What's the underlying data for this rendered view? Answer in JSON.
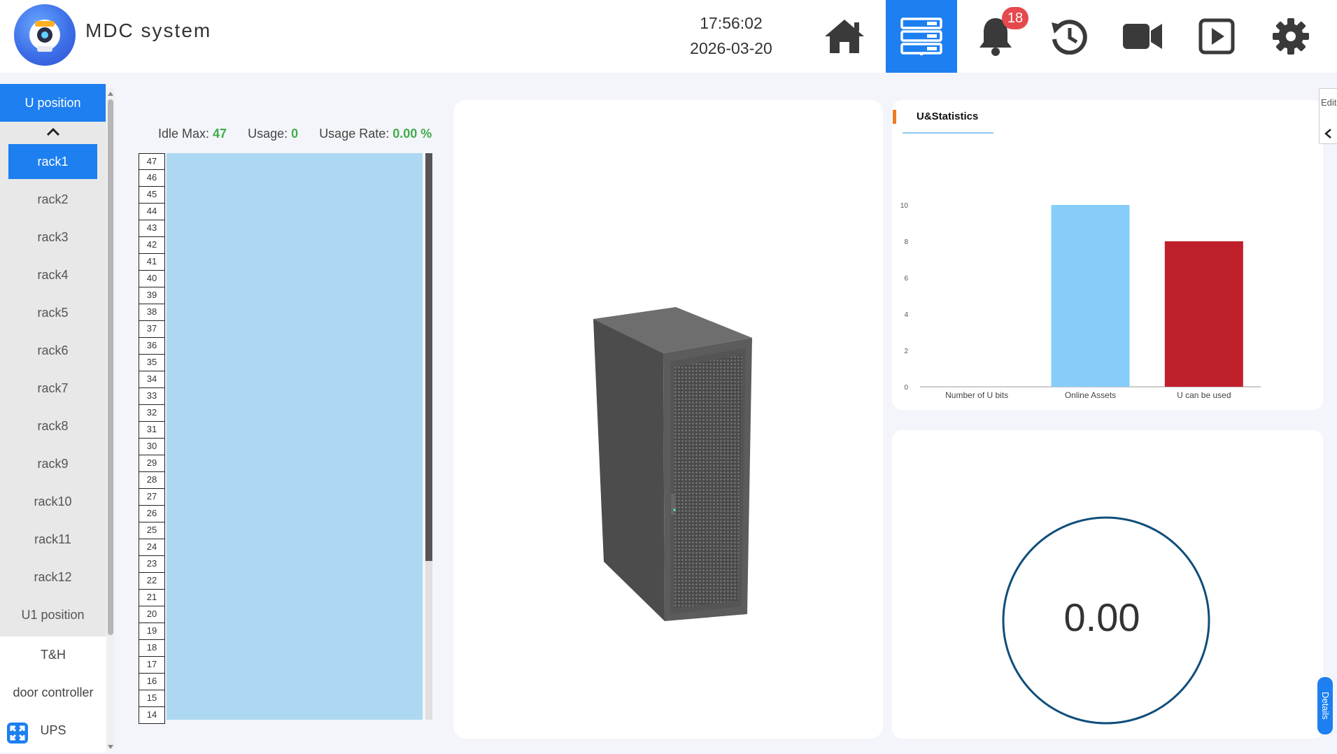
{
  "header": {
    "title": "MDC system",
    "time": "17:56:02",
    "date": "2026-03-20",
    "alarm_count": "18",
    "nav": [
      "home-icon",
      "rack-list-icon",
      "bell-icon",
      "history-icon",
      "video-icon",
      "playback-icon",
      "settings-icon"
    ],
    "active_nav": "rack-list-icon"
  },
  "sidebar": {
    "section": "U position",
    "racks": [
      "rack1",
      "rack2",
      "rack3",
      "rack4",
      "rack5",
      "rack6",
      "rack7",
      "rack8",
      "rack9",
      "rack10",
      "rack11",
      "rack12",
      "U1 position"
    ],
    "active_rack": "rack1",
    "other_items": [
      "T&H",
      "door controller",
      "UPS"
    ]
  },
  "usage": {
    "idle_label": "Idle Max:",
    "idle_value": "47",
    "usage_label": "Usage:",
    "usage_value": "0",
    "rate_label": "Usage Rate:",
    "rate_value": "0.00 %"
  },
  "u_slots": [
    "47",
    "46",
    "45",
    "44",
    "43",
    "42",
    "41",
    "40",
    "39",
    "38",
    "37",
    "36",
    "35",
    "34",
    "33",
    "32",
    "31",
    "30",
    "29",
    "28",
    "27",
    "26",
    "25",
    "24",
    "23",
    "22",
    "21",
    "20",
    "19",
    "18",
    "17",
    "16",
    "15",
    "14"
  ],
  "stats": {
    "title": "U&Statistics",
    "edit_label": "Edit"
  },
  "chart_data": {
    "type": "bar",
    "categories": [
      "Number of U bits",
      "Online Assets",
      "U can be used"
    ],
    "values": [
      0,
      10,
      8
    ],
    "colors": [
      "#87cdf9",
      "#87cdf9",
      "#c0202b"
    ],
    "yticks": [
      0,
      2,
      4,
      6,
      8,
      10
    ],
    "ylim": [
      0,
      10
    ]
  },
  "gauge": {
    "value": "0.00",
    "details_label": "Details"
  }
}
